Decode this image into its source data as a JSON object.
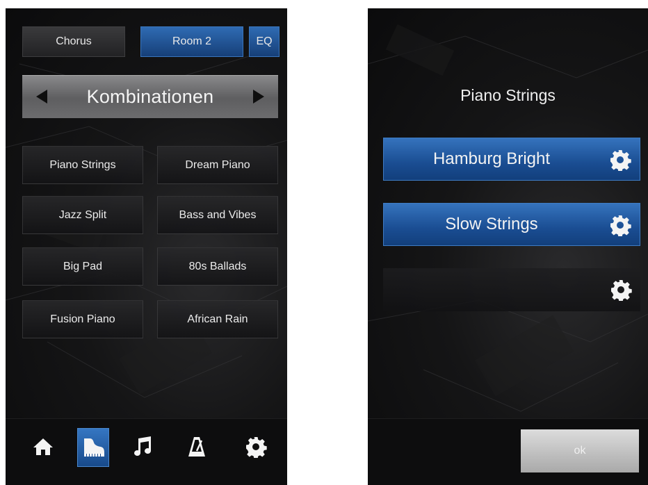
{
  "left_screen": {
    "tabs": [
      {
        "label": "Chorus",
        "active": false
      },
      {
        "label": "Room 2",
        "active": true
      },
      {
        "label": "EQ",
        "active": true
      }
    ],
    "category": {
      "title": "Kombinationen"
    },
    "presets": [
      "Piano Strings",
      "Dream Piano",
      "Jazz Split",
      "Bass and Vibes",
      "Big Pad",
      "80s Ballads",
      "Fusion Piano",
      "African Rain"
    ],
    "nav": [
      {
        "icon": "home-icon",
        "active": false
      },
      {
        "icon": "grand-piano-icon",
        "active": true
      },
      {
        "icon": "music-note-icon",
        "active": false
      },
      {
        "icon": "metronome-icon",
        "active": false
      },
      {
        "icon": "gear-icon",
        "active": false
      }
    ]
  },
  "right_screen": {
    "title": "Piano Strings",
    "slots": [
      {
        "label": "Hamburg Bright",
        "filled": true,
        "icon": "gear-icon"
      },
      {
        "label": "Slow Strings",
        "filled": true,
        "icon": "gear-icon"
      },
      {
        "label": "",
        "filled": false,
        "icon": "gear-icon"
      }
    ],
    "ok_label": "ok"
  },
  "colors": {
    "accent_blue": "#1f5aa6",
    "panel_background": "#131314",
    "category_bar": "#707072",
    "ok_button": "#c4c4c4"
  }
}
